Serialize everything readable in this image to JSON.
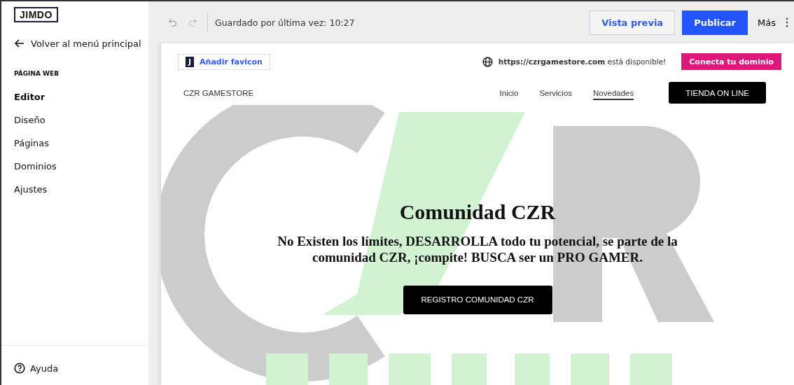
{
  "sidebar": {
    "logo": "JIMDO",
    "back_link": "Volver al menú principal",
    "section_title": "PÁGINA WEB",
    "items": [
      {
        "label": "Editor",
        "selected": true
      },
      {
        "label": "Diseño",
        "selected": false
      },
      {
        "label": "Páginas",
        "selected": false
      },
      {
        "label": "Dominios",
        "selected": false
      },
      {
        "label": "Ajustes",
        "selected": false
      }
    ],
    "help": "Ayuda"
  },
  "toolbar": {
    "saved_status": "Guardado por última vez: 10:27",
    "preview_button": "Vista previa",
    "publish_button": "Publicar",
    "more_menu": "Más"
  },
  "site": {
    "favicon_badge": "J",
    "favicon_button": "Añadir favicon",
    "domain_notice": "**https://czrgamestore.com** está disponible!",
    "domain_button": "Conecta tu dominio",
    "brand": "CZR GAMESTORE",
    "nav": [
      {
        "label": "Inicio",
        "selected": false
      },
      {
        "label": "Servicios",
        "selected": false
      },
      {
        "label": "Novedades",
        "selected": true
      }
    ],
    "shop_button": "TIENDA ON LINE",
    "hero": {
      "title": "Comunidad CZR",
      "text": "No Existen los límites, DESARROLLA todo tu potencial, se parte de la comunidad CZR, ¡compite! BUSCA ser un PRO GAMER.",
      "button": "REGISTRO COMUNIDAD CZR"
    }
  }
}
